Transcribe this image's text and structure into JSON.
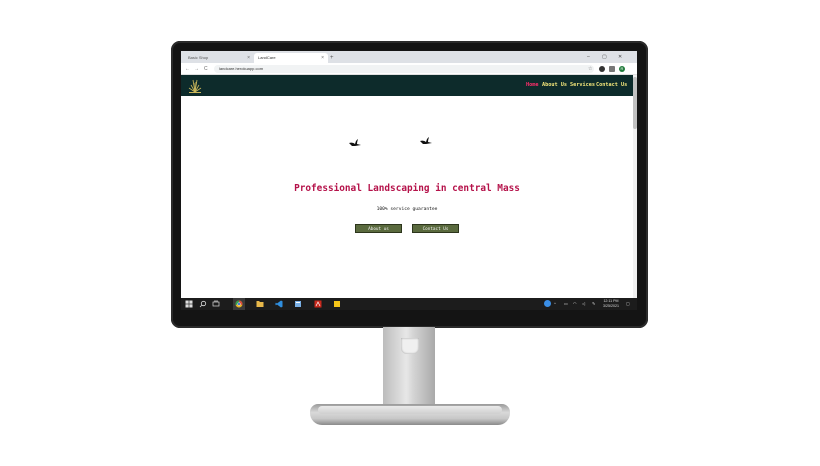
{
  "browser": {
    "tabs": [
      {
        "label": "Basic Shop",
        "active": false
      },
      {
        "label": "LandCare",
        "active": true
      }
    ],
    "url": "landcare.herokuapp.com",
    "new_tab_glyph": "+",
    "close_glyph": "×",
    "window_controls": [
      "–",
      "▢",
      "✕"
    ],
    "nav_glyphs": {
      "back": "←",
      "forward": "→",
      "reload": "C"
    },
    "star_glyph": "☆",
    "profile_initial": "R"
  },
  "site": {
    "nav": [
      {
        "label": "Home",
        "current": true
      },
      {
        "label": "About Us",
        "current": false
      },
      {
        "label": "Services",
        "current": false
      },
      {
        "label": "Contact Us",
        "current": false
      }
    ],
    "headline": "Professional Landscaping in central Mass",
    "subline": "100% service guarantee",
    "buttons": {
      "about": "About us",
      "contact": "Contact Us"
    }
  },
  "taskbar": {
    "clock_time": "12:11 PM",
    "clock_date": "3/25/2021"
  },
  "colors": {
    "nav_bg": "#0d2b2b",
    "nav_link": "#f2e57a",
    "nav_active": "#ff2e6b",
    "headline": "#b5124a",
    "button_bg": "#5a6a3e"
  },
  "icons": [
    "windows-start-icon",
    "search-icon",
    "task-view-icon",
    "chrome-icon",
    "file-explorer-icon",
    "vscode-icon",
    "app-icon",
    "acrobat-icon",
    "sticky-notes-icon",
    "bird-icon",
    "grass-logo-icon"
  ]
}
